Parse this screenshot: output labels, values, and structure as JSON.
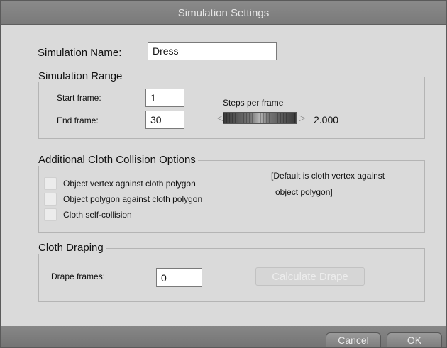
{
  "window": {
    "title": "Simulation Settings"
  },
  "simulation_name": {
    "label": "Simulation Name:",
    "value": "Dress"
  },
  "range": {
    "legend": "Simulation Range",
    "start_label": "Start frame:",
    "start_value": "1",
    "end_label": "End frame:",
    "end_value": "30",
    "steps_label": "Steps per frame",
    "steps_value": "2.000",
    "left_arrow": "◁",
    "right_arrow": "▷"
  },
  "collision": {
    "legend": "Additional Cloth Collision Options",
    "options": [
      {
        "label": "Object vertex against cloth polygon",
        "checked": false
      },
      {
        "label": "Object polygon against cloth polygon",
        "checked": false
      },
      {
        "label": "Cloth self-collision",
        "checked": false
      }
    ],
    "note_line1": "[Default is cloth vertex against",
    "note_line2": "object polygon]"
  },
  "draping": {
    "legend": "Cloth Draping",
    "drape_label": "Drape frames:",
    "drape_value": "0",
    "calculate_label": "Calculate Drape"
  },
  "buttons": {
    "cancel": "Cancel",
    "ok": "OK"
  },
  "colors": {
    "title_bar": "#7f7f7f",
    "panel": "#dadada",
    "button": "#8a8a8a"
  }
}
